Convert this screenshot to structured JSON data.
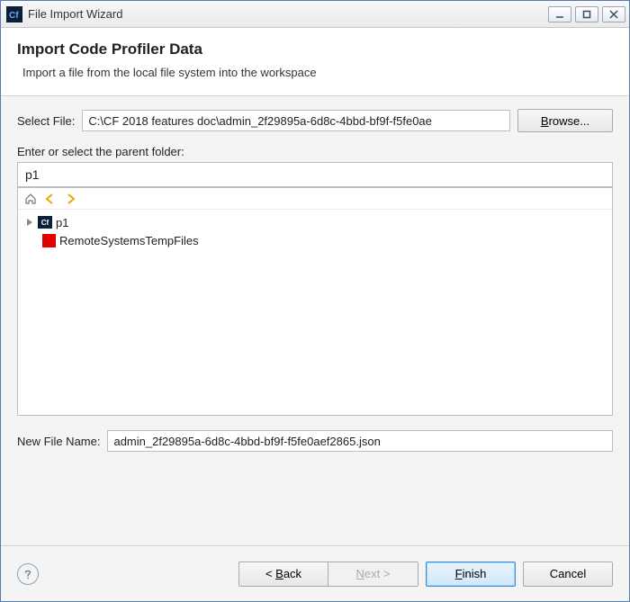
{
  "window": {
    "title": "File Import Wizard"
  },
  "header": {
    "title": "Import Code Profiler Data",
    "description": "Import a file from the local file system into the workspace"
  },
  "select_file": {
    "label": "Select File:",
    "value": "C:\\CF 2018 features doc\\admin_2f29895a-6d8c-4bbd-bf9f-f5fe0ae",
    "browse_label": "Browse..."
  },
  "parent_folder": {
    "label": "Enter or select the parent folder:",
    "value": "p1"
  },
  "tree": {
    "items": [
      {
        "name": "p1",
        "icon": "cf-project",
        "expandable": true
      },
      {
        "name": "RemoteSystemsTempFiles",
        "icon": "red-folder",
        "expandable": false
      }
    ]
  },
  "new_file": {
    "label": "New File Name:",
    "value": "admin_2f29895a-6d8c-4bbd-bf9f-f5fe0aef2865.json"
  },
  "buttons": {
    "back": "< Back",
    "next": "Next >",
    "finish": "Finish",
    "cancel": "Cancel"
  }
}
